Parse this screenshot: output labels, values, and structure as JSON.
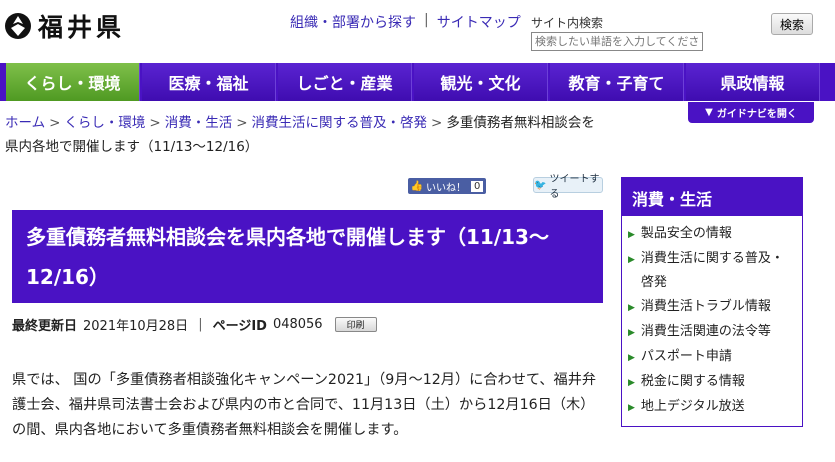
{
  "site": {
    "logo_text": "福井県",
    "top_links": [
      "組織・部署から探す",
      "サイトマップ"
    ],
    "separator": "|",
    "search_label": "サイト内検索",
    "search_placeholder": "検索したい単語を入力してください",
    "search_button": "検索"
  },
  "nav": {
    "items": [
      "くらし・環境",
      "医療・福祉",
      "しごと・産業",
      "観光・文化",
      "教育・子育て",
      "県政情報"
    ],
    "active_index": 0
  },
  "breadcrumb": {
    "items": [
      "ホーム",
      "くらし・環境",
      "消費・生活",
      "消費生活に関する普及・啓発"
    ],
    "separator": ">",
    "current": "多重債務者無料相談会を県内各地で開催します（11/13〜12/16）"
  },
  "guide_button": "ガイドナビを開く",
  "social": {
    "like_label": "いいね！",
    "like_count": "0",
    "tweet_label": "ツイートする"
  },
  "article": {
    "title": "多重債務者無料相談会を県内各地で開催します（11/13〜12/16）",
    "updated_label": "最終更新日",
    "updated_date": "2021年10月28日",
    "meta_sep": "|",
    "page_id_label": "ページID",
    "page_id": "048056",
    "print_label": "印刷",
    "body": "県では、 国の「多重債務者相談強化キャンペーン2021」（9月〜12月）に合わせて、福井弁護士会、福井県司法書士会および県内の市と合同で、11月13日（土）から12月16日（木）の間、県内各地において多重債務者無料相談会を開催します。"
  },
  "sidebar": {
    "title": "消費・生活",
    "items": [
      "製品安全の情報",
      "消費生活に関する普及・啓発",
      "消費生活トラブル情報",
      "消費生活関連の法令等",
      "パスポート申請",
      "税金に関する情報",
      "地上デジタル放送"
    ]
  },
  "colors": {
    "brand_purple": "#4a12c4",
    "active_green": "#5fa82c",
    "link_blue": "#3a2bb5"
  }
}
